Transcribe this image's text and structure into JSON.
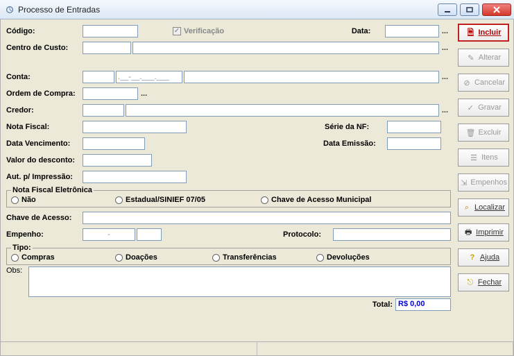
{
  "window": {
    "title": "Processo de Entradas"
  },
  "labels": {
    "codigo": "Código:",
    "verificacao": "Verificação",
    "data": "Data:",
    "centro_custo": "Centro de Custo:",
    "conta": "Conta:",
    "ordem_compra": "Ordem de Compra:",
    "credor": "Credor:",
    "nota_fiscal": "Nota Fiscal:",
    "serie_nf": "Série da NF:",
    "data_venc": "Data Vencimento:",
    "data_emissao": "Data Emissão:",
    "valor_desconto": "Valor do desconto:",
    "aut_impressao": "Aut. p/ Impressão:",
    "nfe_group": "Nota Fiscal Eletrônica",
    "nfe_nao": "Não",
    "nfe_estadual": "Estadual/SINIEF 07/05",
    "nfe_municipal": "Chave de Acesso Municipal",
    "chave_acesso": "Chave de Acesso:",
    "empenho": "Empenho:",
    "protocolo": "Protocolo:",
    "tipo_group": "Tipo:",
    "tipo_compras": "Compras",
    "tipo_doacoes": "Doações",
    "tipo_transf": "Transferências",
    "tipo_devol": "Devoluções",
    "obs": "Obs:",
    "total": "Total:"
  },
  "values": {
    "codigo": "",
    "data": "",
    "centro_custo_code": "",
    "centro_custo_desc": "",
    "conta_a": "",
    "conta_b": ".__-__.___.___",
    "conta_desc": "",
    "ordem_compra": "",
    "credor_code": "",
    "credor_desc": "",
    "nota_fiscal": "",
    "serie_nf": "",
    "data_venc": "",
    "data_emissao": "",
    "valor_desconto": "",
    "aut_impressao": "",
    "chave_acesso": "",
    "empenho_a": "-",
    "empenho_b": "",
    "protocolo": "",
    "obs": "",
    "total": "R$ 0,00"
  },
  "buttons": {
    "incluir": "Incluir",
    "alterar": "Alterar",
    "cancelar": "Cancelar",
    "gravar": "Gravar",
    "excluir": "Excluir",
    "itens": "Itens",
    "empenhos": "Empenhos",
    "localizar": "Localizar",
    "imprimir": "Imprimir",
    "ajuda": "Ajuda",
    "fechar": "Fechar"
  }
}
